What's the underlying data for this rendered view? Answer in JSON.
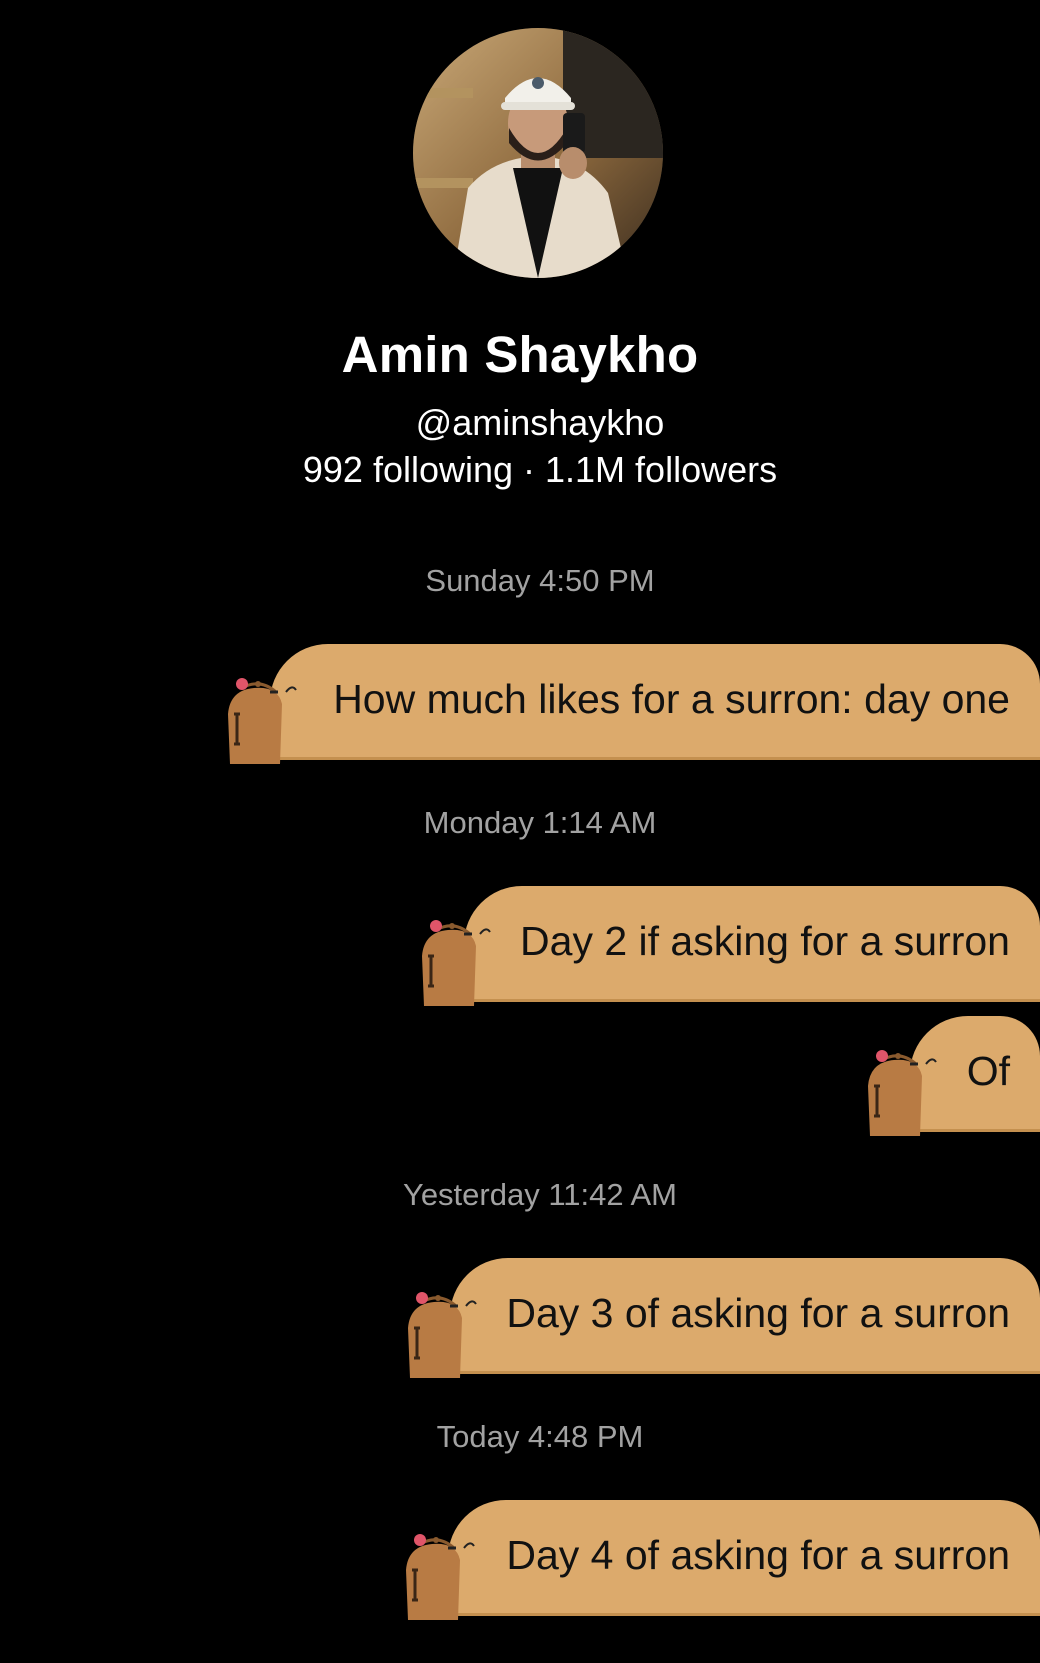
{
  "profile": {
    "name": "Amin Shaykho",
    "handle": "@aminshaykho",
    "stats": "992 following · 1.1M followers"
  },
  "messages": [
    {
      "timestamp": "Sunday 4:50 PM",
      "text": "How much likes for a surron: day one"
    },
    {
      "timestamp": "Monday 1:14 AM",
      "text": "Day 2 if asking for a surron"
    },
    {
      "timestamp": "",
      "text": "Of"
    },
    {
      "timestamp": "Yesterday 11:42 AM",
      "text": "Day 3 of asking for a surron"
    },
    {
      "timestamp": "Today 4:48 PM",
      "text": "Day 4 of asking for a surron"
    }
  ],
  "colors": {
    "background": "#000000",
    "bubble": "#dcaa6c",
    "timestamp": "#a2a2a2"
  },
  "icons": {
    "bubble_decoration": "capybara-icon"
  }
}
